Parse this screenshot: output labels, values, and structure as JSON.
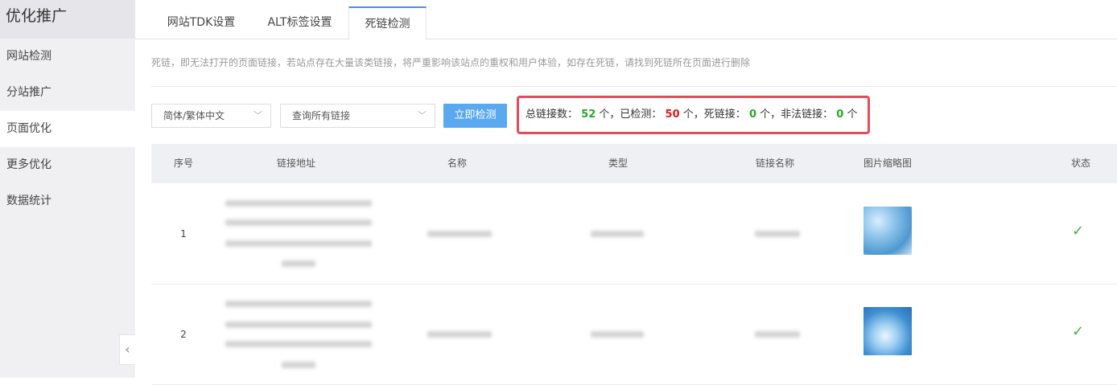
{
  "sidebar": {
    "title": "优化推广",
    "items": [
      {
        "label": "网站检测"
      },
      {
        "label": "分站推广"
      },
      {
        "label": "页面优化"
      },
      {
        "label": "更多优化"
      },
      {
        "label": "数据统计"
      }
    ],
    "active_index": 2,
    "collapse_icon": "chevron-left-icon"
  },
  "tabs": [
    {
      "label": "网站TDK设置"
    },
    {
      "label": "ALT标签设置"
    },
    {
      "label": "死链检测"
    }
  ],
  "active_tab": 2,
  "description": "死链，即无法打开的页面链接，若站点存在大量该类链接，将严重影响该站点的重权和用户体验，如存在死链，请找到死链所在页面进行删除",
  "filters": {
    "language_select": "简体/繁体中文",
    "link_select": "查询所有链接",
    "check_button": "立即检测"
  },
  "stats": {
    "total_label": "总链接数：",
    "total": "52",
    "total_unit": "个，已检测：",
    "checked": "50",
    "checked_unit": "个，死链接：",
    "dead": "0",
    "dead_unit": "个，非法链接：",
    "illegal": "0",
    "illegal_unit": "个"
  },
  "table": {
    "headers": [
      "序号",
      "链接地址",
      "名称",
      "类型",
      "链接名称",
      "图片缩略图",
      "状态"
    ],
    "rows": [
      {
        "index": "1",
        "status_icon": "check-icon"
      },
      {
        "index": "2",
        "status_icon": "check-icon"
      }
    ]
  },
  "colors": {
    "accent": "#4a90e2",
    "button": "#5aa9f0",
    "highlight_border": "#e44c5d",
    "green": "#26a826",
    "red": "#e01818"
  }
}
